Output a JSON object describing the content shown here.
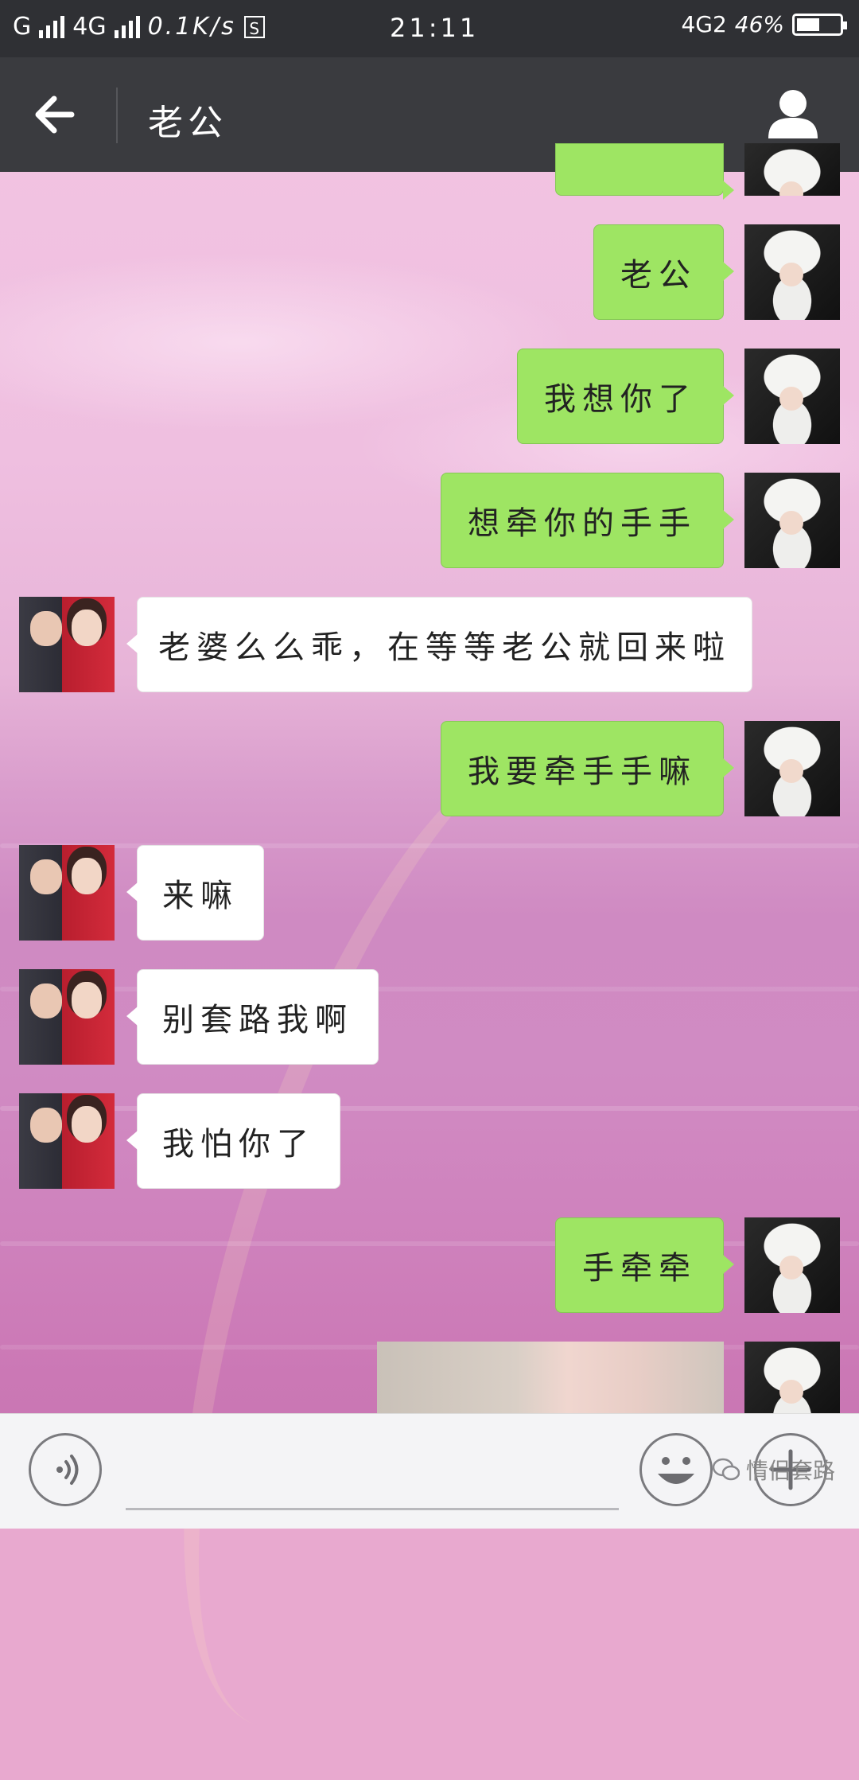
{
  "status_bar": {
    "carrier_1": "G",
    "carrier_2": "4G",
    "net_speed": "0.1K/s",
    "s_icon": "S",
    "time": "21:11",
    "network": "4G2",
    "battery": "46%"
  },
  "header": {
    "title": "老公",
    "back_icon": "arrow-left-icon",
    "profile_icon": "person-icon"
  },
  "messages": [
    {
      "side": "me",
      "text": "老公"
    },
    {
      "side": "me",
      "text": "我想你了"
    },
    {
      "side": "me",
      "text": "想牵你的手手"
    },
    {
      "side": "other",
      "text": "老婆么么乖，在等等老公就回来啦"
    },
    {
      "side": "me",
      "text": "我要牵手手嘛"
    },
    {
      "side": "other",
      "text": "来嘛"
    },
    {
      "side": "other",
      "text": "别套路我啊"
    },
    {
      "side": "other",
      "text": "我怕你了"
    },
    {
      "side": "me",
      "text": "手牵牵"
    },
    {
      "side": "me",
      "type": "image"
    }
  ],
  "bottom_bar": {
    "voice_icon": "voice-icon",
    "emoji_icon": "emoji-icon",
    "plus_icon": "plus-icon",
    "watermark": "情侣套路"
  },
  "colors": {
    "my_bubble": "#9ee563",
    "other_bubble": "#ffffff",
    "header_bg": "#3a3b3f",
    "status_bg": "#2f3034"
  }
}
